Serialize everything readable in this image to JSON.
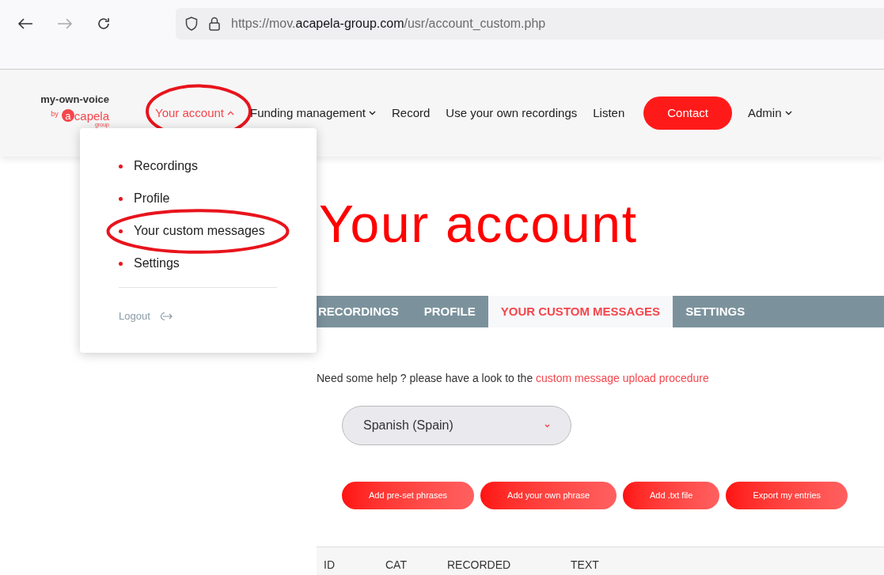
{
  "browser": {
    "url": {
      "scheme": "https://mov.",
      "domain": "acapela-group.com",
      "path": "/usr/account_custom.php"
    }
  },
  "logo": {
    "name": "my-own-voice",
    "by": "by",
    "mark": "a",
    "word": "capela",
    "sub": "group"
  },
  "nav": [
    {
      "label": "Your account",
      "kind": "menu",
      "expanded": true,
      "selected": true,
      "circled": true
    },
    {
      "label": "Funding management",
      "kind": "menu",
      "expanded": false,
      "selected": false,
      "circled": false
    },
    {
      "label": "Record",
      "kind": "link",
      "selected": false,
      "circled": false
    },
    {
      "label": "Use your own recordings",
      "kind": "link",
      "selected": false,
      "circled": false
    },
    {
      "label": "Listen",
      "kind": "link",
      "selected": false,
      "circled": false
    },
    {
      "label": "Contact",
      "kind": "button",
      "selected": false,
      "circled": false
    },
    {
      "label": "Admin",
      "kind": "menu",
      "expanded": false,
      "selected": false,
      "circled": false
    }
  ],
  "dropdown": {
    "items": [
      {
        "label": "Recordings",
        "circled": false
      },
      {
        "label": "Profile",
        "circled": false
      },
      {
        "label": "Your custom messages",
        "circled": true
      },
      {
        "label": "Settings",
        "circled": false
      }
    ],
    "logout": "Logout"
  },
  "heading": "Your account",
  "tabs": [
    {
      "label": "RECORDINGS",
      "selected": false
    },
    {
      "label": "PROFILE",
      "selected": false
    },
    {
      "label": "YOUR CUSTOM MESSAGES",
      "selected": true
    },
    {
      "label": "SETTINGS",
      "selected": false
    }
  ],
  "help": {
    "text": "Need some help ? please have a look to the",
    "link": "custom message upload procedure"
  },
  "language_select": {
    "value": "Spanish (Spain)"
  },
  "buttons": [
    "Add pre-set phrases",
    "Add your own phrase",
    "Add .txt file",
    "Export my entries"
  ],
  "table": {
    "columns": [
      "ID",
      "CAT",
      "RECORDED",
      "TEXT"
    ]
  }
}
